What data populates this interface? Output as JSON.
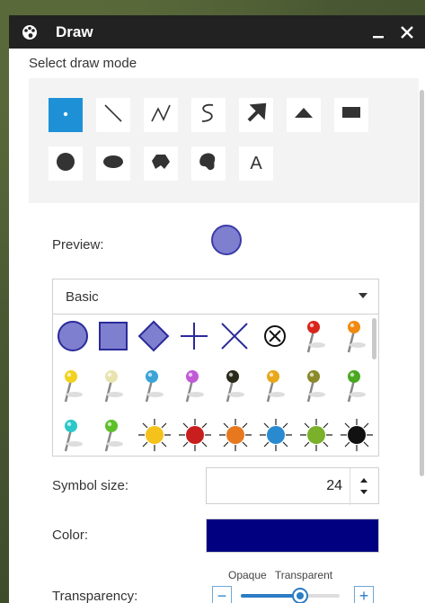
{
  "window": {
    "title": "Draw",
    "icons": {
      "app": "palette-icon",
      "minimize": "minimize-icon",
      "close": "close-icon"
    }
  },
  "draw_mode": {
    "label": "Select draw mode",
    "modes": [
      {
        "name": "point",
        "icon": "point-icon",
        "active": true
      },
      {
        "name": "line",
        "icon": "line-icon",
        "active": false
      },
      {
        "name": "polyline",
        "icon": "polyline-icon",
        "active": false
      },
      {
        "name": "freehand-polyline",
        "icon": "freehand-line-icon",
        "active": false
      },
      {
        "name": "arrow",
        "icon": "arrow-icon",
        "active": false
      },
      {
        "name": "triangle",
        "icon": "triangle-icon",
        "active": false
      },
      {
        "name": "rectangle",
        "icon": "rectangle-icon",
        "active": false
      },
      {
        "name": "circle",
        "icon": "circle-icon",
        "active": false
      },
      {
        "name": "ellipse",
        "icon": "ellipse-icon",
        "active": false
      },
      {
        "name": "polygon",
        "icon": "polygon-icon",
        "active": false
      },
      {
        "name": "freehand-polygon",
        "icon": "freehand-polygon-icon",
        "active": false
      },
      {
        "name": "text",
        "icon": "text-icon",
        "label": "A",
        "active": false
      }
    ]
  },
  "preview": {
    "label": "Preview:",
    "fill": "#7f7fd0",
    "stroke": "#3b3ba8"
  },
  "symbol_set": {
    "selected": "Basic",
    "symbols": [
      "circle-symbol",
      "square-symbol",
      "diamond-symbol",
      "cross-symbol",
      "x-symbol",
      "circle-x-symbol",
      "pushpin-red",
      "pushpin-orange",
      "pushpin-yellow",
      "pushpin-cream",
      "pushpin-blue",
      "pushpin-violet",
      "pushpin-black",
      "pushpin-gold",
      "pushpin-olive",
      "pushpin-green",
      "pushpin-cyan",
      "pushpin-lime",
      "burst-yellow",
      "burst-red",
      "burst-orange",
      "burst-blue",
      "burst-green",
      "burst-black"
    ]
  },
  "symbol_size": {
    "label": "Symbol size:",
    "value": "24"
  },
  "color": {
    "label": "Color:",
    "value": "#000080"
  },
  "transparency": {
    "label": "Transparency:",
    "left_label": "Opaque",
    "right_label": "Transparent",
    "minus": "−",
    "plus": "+",
    "level": 0.6
  },
  "colors": {
    "accent": "#1e90d6",
    "titlebar": "#222222",
    "panel": "#f3f3f3"
  }
}
